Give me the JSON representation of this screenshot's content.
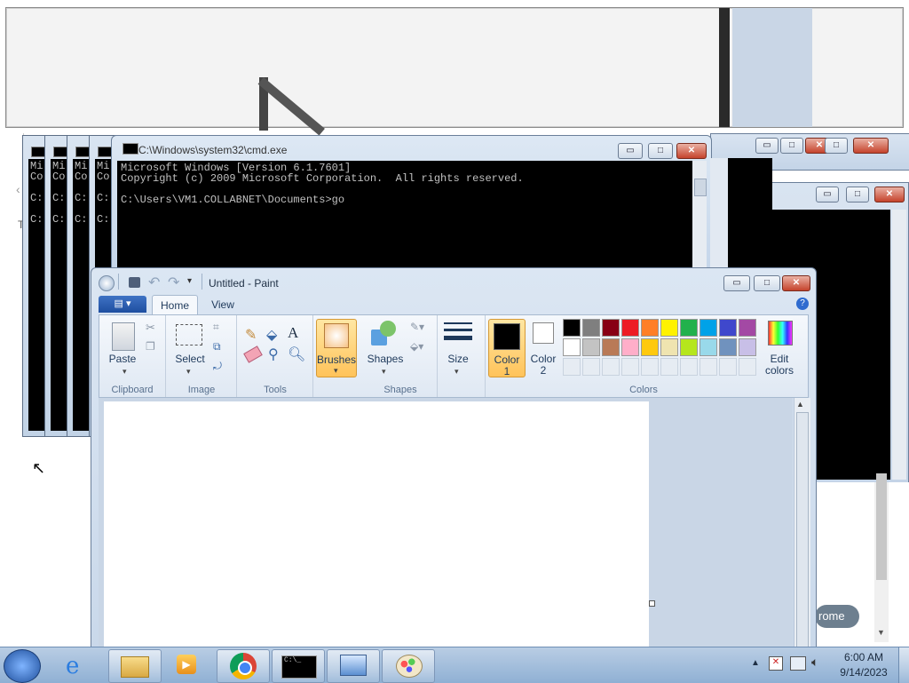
{
  "cmd": {
    "title": "C:\\Windows\\system32\\cmd.exe",
    "line1": "Microsoft Windows [Version 6.1.7601]",
    "line2": "Copyright (c) 2009 Microsoft Corporation.  All rights reserved.",
    "line3": "C:\\Users\\VM1.COLLABNET\\Documents>go",
    "stack_text": "Mi\nCo\n\nC:\n\nC:"
  },
  "paint": {
    "title": "Untitled - Paint",
    "tabs": [
      "Home",
      "View"
    ],
    "groups": {
      "clipboard": "Clipboard",
      "image": "Image",
      "tools": "Tools",
      "shapes": "Shapes",
      "colors": "Colors"
    },
    "buttons": {
      "paste": "Paste",
      "select": "Select",
      "brushes": "Brushes",
      "shapes": "Shapes",
      "size": "Size",
      "color1_a": "Color",
      "color1_b": "1",
      "color2_a": "Color",
      "color2_b": "2",
      "edit_colors_a": "Edit",
      "edit_colors_b": "colors"
    },
    "palette_row1": [
      "#000000",
      "#7f7f7f",
      "#880015",
      "#ed1c24",
      "#ff7f27",
      "#fff200",
      "#22b14c",
      "#00a2e8",
      "#3f48cc",
      "#a349a4"
    ],
    "palette_row2": [
      "#ffffff",
      "#c3c3c3",
      "#b97a57",
      "#ffaec9",
      "#ffc90e",
      "#efe4b0",
      "#b5e61d",
      "#99d9ea",
      "#7092be",
      "#c8bfe7"
    ]
  },
  "background": {
    "chrome_fragment": "rome",
    "t_fragment": "T"
  },
  "taskbar": {
    "time": "6:00 AM",
    "date": "9/14/2023"
  }
}
